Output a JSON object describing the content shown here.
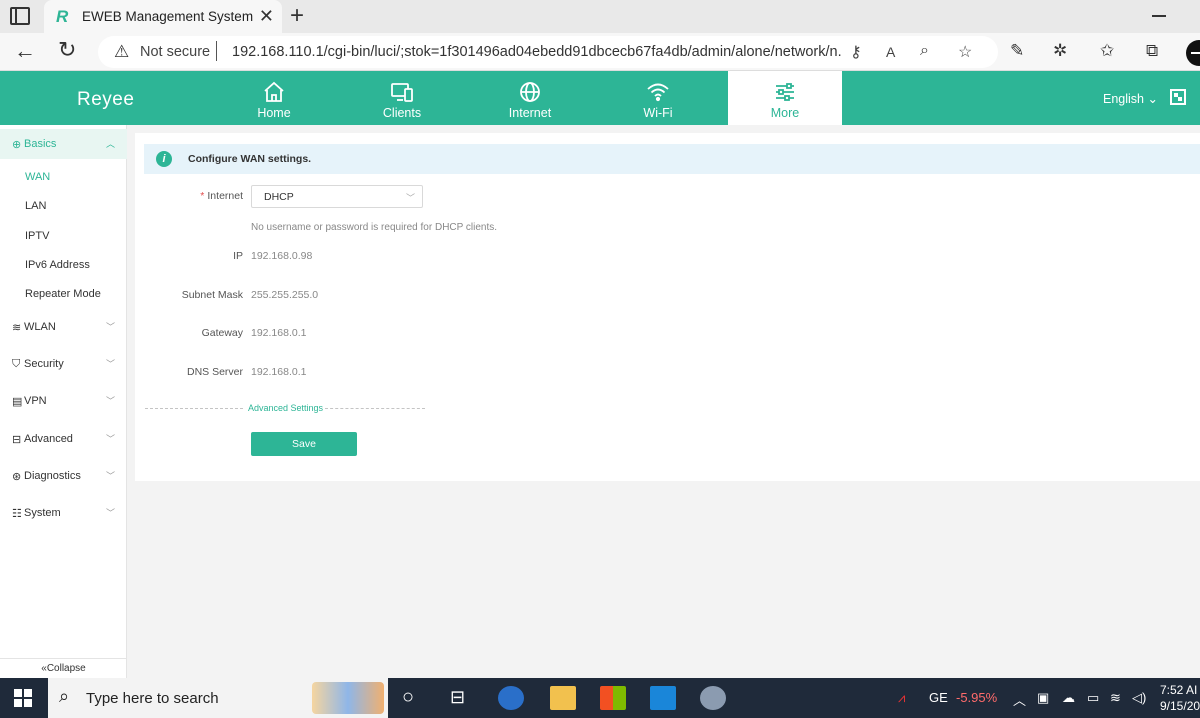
{
  "browser": {
    "tab_title": "EWEB Management System",
    "tab_favicon": "R",
    "security_label": "Not secure",
    "url": "192.168.110.1/cgi-bin/luci/;stok=1f301496ad04ebedd91dbcecb67fa4db/admin/alone/network/n..."
  },
  "header": {
    "logo": "Reyee",
    "nav": [
      {
        "label": "Home",
        "icon": "home-icon"
      },
      {
        "label": "Clients",
        "icon": "devices-icon"
      },
      {
        "label": "Internet",
        "icon": "globe-icon"
      },
      {
        "label": "Wi-Fi",
        "icon": "wifi-icon"
      },
      {
        "label": "More",
        "icon": "sliders-icon",
        "active": true
      }
    ],
    "language": "English",
    "accent_color": "#2db596"
  },
  "sidebar": {
    "groups": [
      {
        "label": "Basics",
        "icon": "globe-icon",
        "open": true
      },
      {
        "label": "WLAN",
        "icon": "wifi-icon"
      },
      {
        "label": "Security",
        "icon": "shield-icon"
      },
      {
        "label": "VPN",
        "icon": "vpn-icon"
      },
      {
        "label": "Advanced",
        "icon": "briefcase-icon"
      },
      {
        "label": "Diagnostics",
        "icon": "diagnostics-icon"
      },
      {
        "label": "System",
        "icon": "system-icon"
      }
    ],
    "basics_items": [
      "WAN",
      "LAN",
      "IPTV",
      "IPv6 Address",
      "Repeater Mode"
    ],
    "active_item": "WAN",
    "collapse_label": "Collapse"
  },
  "content": {
    "banner": "Configure WAN settings.",
    "internet_label": "Internet",
    "internet_value": "DHCP",
    "dhcp_hint": "No username or password is required for DHCP clients.",
    "fields": [
      {
        "label": "IP",
        "value": "192.168.0.98"
      },
      {
        "label": "Subnet Mask",
        "value": "255.255.255.0"
      },
      {
        "label": "Gateway",
        "value": "192.168.0.1"
      },
      {
        "label": "DNS Server",
        "value": "192.168.0.1"
      }
    ],
    "advanced_link": "Advanced Settings",
    "save_label": "Save"
  },
  "taskbar": {
    "search_placeholder": "Type here to search",
    "stock_name": "GE",
    "stock_change": "-5.95%",
    "time": "7:52 AI",
    "date": "9/15/20"
  }
}
